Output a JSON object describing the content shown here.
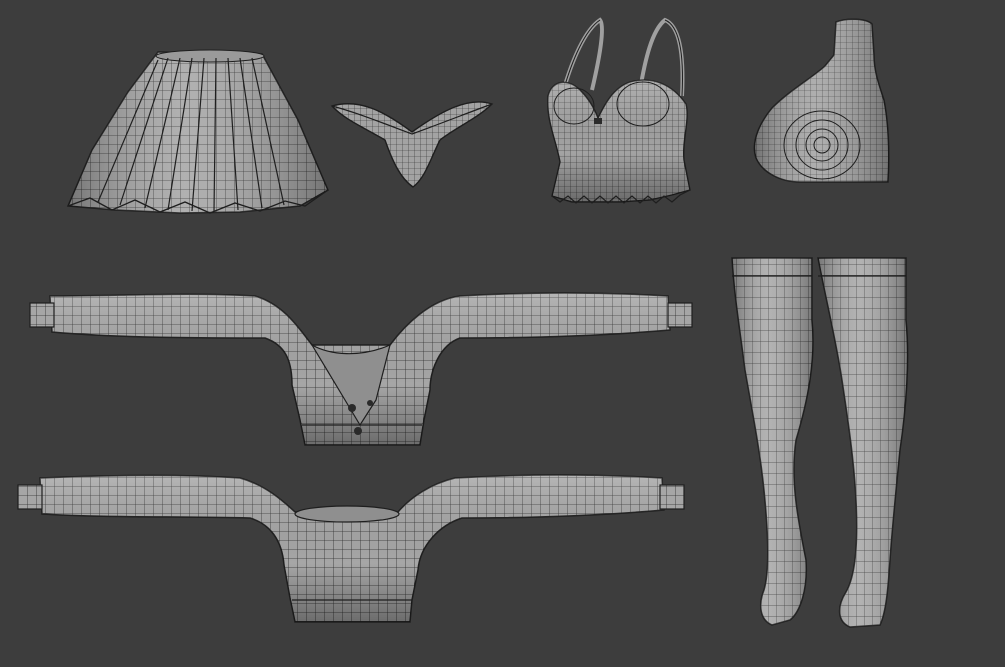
{
  "viewport": {
    "background_color": "#3d3d3d",
    "mesh_fill_color": "#a9a9a9",
    "wire_color": "#2a2a2a",
    "outline_color": "#1e1e1e"
  },
  "objects": [
    {
      "id": "pleated-skirt",
      "icon": "skirt-mesh"
    },
    {
      "id": "thong",
      "icon": "thong-mesh"
    },
    {
      "id": "camisole-top",
      "icon": "camisole-mesh"
    },
    {
      "id": "bust-form",
      "icon": "bust-mesh"
    },
    {
      "id": "cardigan-cropped",
      "icon": "cardigan-mesh"
    },
    {
      "id": "sweater-cropped",
      "icon": "sweater-mesh"
    },
    {
      "id": "thigh-high-stockings",
      "icon": "stockings-mesh"
    }
  ]
}
